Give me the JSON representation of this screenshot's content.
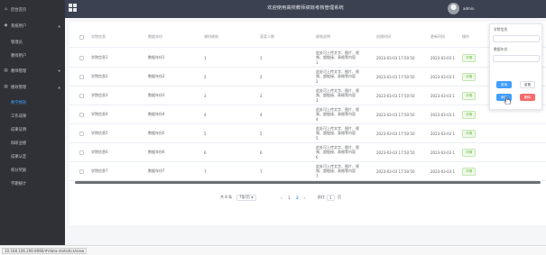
{
  "header": {
    "title": "欢迎使用高校教师绩效考核管理系统",
    "user_name": "admin"
  },
  "sidebar": {
    "items": [
      {
        "label": "后台首页",
        "icon": "home-icon",
        "expandable": false
      },
      {
        "label": "系统用户",
        "icon": "user-icon",
        "expandable": true
      },
      {
        "label": "管理员",
        "icon": "",
        "expandable": false
      },
      {
        "label": "教师用户",
        "icon": "",
        "expandable": false
      },
      {
        "label": "教师管理",
        "icon": "folder-icon",
        "expandable": true
      },
      {
        "label": "绩效管理",
        "icon": "folder-icon",
        "expandable": true
      },
      {
        "label": "教学绩效",
        "icon": "",
        "expandable": false,
        "active": true
      },
      {
        "label": "工作成果",
        "icon": "",
        "expandable": false
      },
      {
        "label": "成果证明",
        "icon": "",
        "expandable": false
      },
      {
        "label": "科研业绩",
        "icon": "",
        "expandable": false
      },
      {
        "label": "成果认定",
        "icon": "",
        "expandable": false
      },
      {
        "label": "积分奖励",
        "icon": "",
        "expandable": false
      },
      {
        "label": "学期统计",
        "icon": "",
        "expandable": false
      }
    ]
  },
  "table": {
    "columns": [
      "学院信息",
      "数据年份",
      "课时绩效",
      "获奖人数",
      "绩效说明",
      "创建时间",
      "更新时间",
      "操作"
    ],
    "rows": [
      {
        "college": "学院信息1",
        "year": "数据年份1",
        "hours": "1",
        "winners": "1",
        "desc": [
          "此处可上传文字、图片、视",
          "频、超链接、表格等内容",
          "1"
        ],
        "created": "2023-03-03 17:50:50",
        "updated": "2023-03-03 1",
        "action": "详情"
      },
      {
        "college": "学院信息2",
        "year": "数据年份2",
        "hours": "2",
        "winners": "2",
        "desc": [
          "此处可上传文字、图片、视",
          "频、超链接、表格等内容",
          "2"
        ],
        "created": "2023-03-03 17:50:50",
        "updated": "2023-03-03 1",
        "action": "详情"
      },
      {
        "college": "学院信息3",
        "year": "数据年份3",
        "hours": "3",
        "winners": "3",
        "desc": [
          "此处可上传文字、图片、视",
          "频、超链接、表格等内容",
          "3"
        ],
        "created": "2023-03-03 17:50:50",
        "updated": "2023-03-03 1",
        "action": "详情"
      },
      {
        "college": "学院信息4",
        "year": "数据年份4",
        "hours": "4",
        "winners": "4",
        "desc": [
          "此处可上传文字、图片、视",
          "频、超链接、表格等内容",
          "4"
        ],
        "created": "2023-03-03 17:50:50",
        "updated": "2023-03-03 1",
        "action": "详情"
      },
      {
        "college": "学院信息5",
        "year": "数据年份5",
        "hours": "5",
        "winners": "5",
        "desc": [
          "此处可上传文字、图片、视",
          "频、超链接、表格等内容",
          "5"
        ],
        "created": "2023-03-03 17:50:50",
        "updated": "2023-03-03 1",
        "action": "详情"
      },
      {
        "college": "学院信息6",
        "year": "数据年份6",
        "hours": "6",
        "winners": "6",
        "desc": [
          "此处可上传文字、图片、视",
          "频、超链接、表格等内容",
          "6"
        ],
        "created": "2023-03-03 17:50:50",
        "updated": "2023-03-03 1",
        "action": "详情"
      },
      {
        "college": "学院信息7",
        "year": "数据年份7",
        "hours": "7",
        "winners": "7",
        "desc": [
          "此处可上传文字、图片、视",
          "频、超链接、表格等内容",
          "7"
        ],
        "created": "2023-03-03 17:50:50",
        "updated": "2023-03-03 1",
        "action": "详情"
      }
    ]
  },
  "pagination": {
    "total": "共 8 条",
    "page_size": "7条/页",
    "prev": "‹",
    "pages": [
      "1",
      "2"
    ],
    "active_page": "2",
    "next": "›",
    "goto_label": "前往",
    "goto_value": "1",
    "page_unit": "页"
  },
  "search_panel": {
    "field1_label": "学院信息",
    "field2_label": "数据年份",
    "search_button": "查询",
    "reset_button": "重置",
    "add_button": "添加",
    "delete_button": "删除"
  },
  "status_bar": {
    "url": "10.168.106.206:8080/#/data-statistics/view"
  },
  "colors": {
    "sidebar_bg": "#2f3136",
    "header_bg": "#3b4151",
    "primary": "#409eff",
    "danger": "#f56c6c",
    "success": "#67c23a"
  }
}
